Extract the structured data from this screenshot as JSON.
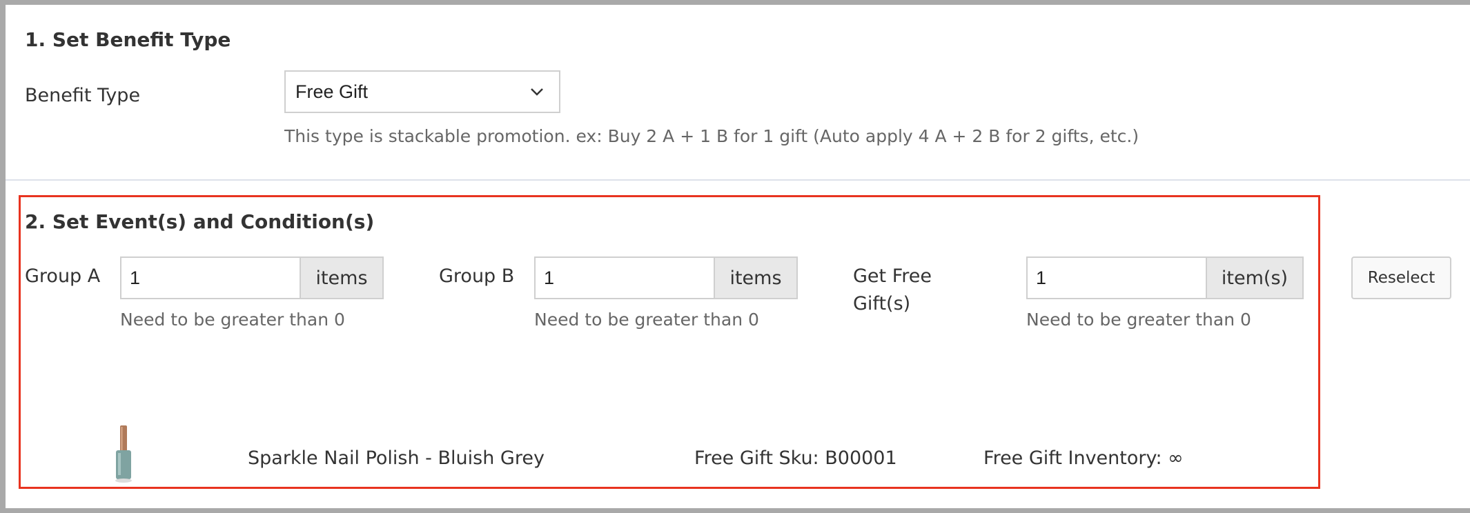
{
  "section1": {
    "title": "1. Set Benefit Type",
    "benefit_label": "Benefit Type",
    "benefit_select_value": "Free Gift",
    "benefit_hint": "This type is stackable promotion. ex: Buy 2 A + 1 B for 1 gift (Auto apply 4 A + 2 B for 2 gifts, etc.)"
  },
  "section2": {
    "title": "2. Set Event(s) and Condition(s)",
    "group_a": {
      "label": "Group A",
      "value": "1",
      "unit": "items",
      "hint": "Need to be greater than 0"
    },
    "group_b": {
      "label": "Group B",
      "value": "1",
      "unit": "items",
      "hint": "Need to be greater than 0"
    },
    "free_gift": {
      "label_line1": "Get Free",
      "label_line2": "Gift(s)",
      "value": "1",
      "unit": "item(s)",
      "hint": "Need to be greater than 0"
    },
    "reselect_label": "Reselect",
    "product": {
      "name": "Sparkle Nail Polish - Bluish Grey",
      "sku": "Free Gift Sku: B00001",
      "inventory": "Free Gift Inventory: ∞"
    }
  },
  "colors": {
    "highlight_border": "#e8331f",
    "addon_bg": "#e8e8e8"
  },
  "icons": {
    "select_chevron": "chevron-down-icon",
    "product_image": "nail-polish-bottle"
  }
}
